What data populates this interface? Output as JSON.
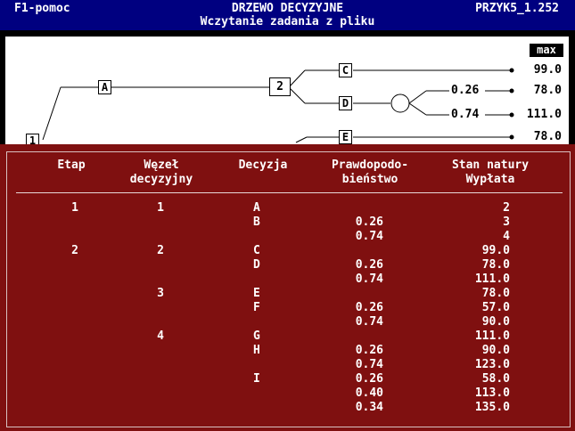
{
  "titlebar": {
    "help": "F1-pomoc",
    "title": "DRZEWO DECYZYJNE",
    "filename": "PRZYK5_1.252",
    "subtitle": "Wczytanie zadania z pliku"
  },
  "tree": {
    "max_label": "max",
    "node_1": "1",
    "node_A": "A",
    "node_2": "2",
    "node_C": "C",
    "node_D": "D",
    "node_E": "E",
    "prob_026": "0.26",
    "prob_074": "0.74",
    "payoff_C": "99.0",
    "payoff_D1": "78.0",
    "payoff_D2": "111.0",
    "payoff_E": "78.0"
  },
  "table": {
    "headers": {
      "stage": "Etap",
      "node": "Węzeł\ndecyzyjny",
      "decision": "Decyzja",
      "probability": "Prawdopodo-\nbieństwo",
      "payoff": "Stan natury\nWypłata"
    },
    "rows": [
      {
        "stage": "1",
        "node": "1",
        "decision": "A",
        "prob": "",
        "payoff": "2"
      },
      {
        "stage": "",
        "node": "",
        "decision": "B",
        "prob": "0.26",
        "payoff": "3"
      },
      {
        "stage": "",
        "node": "",
        "decision": "",
        "prob": "0.74",
        "payoff": "4"
      },
      {
        "stage": "2",
        "node": "2",
        "decision": "C",
        "prob": "",
        "payoff": "99.0"
      },
      {
        "stage": "",
        "node": "",
        "decision": "D",
        "prob": "0.26",
        "payoff": "78.0"
      },
      {
        "stage": "",
        "node": "",
        "decision": "",
        "prob": "0.74",
        "payoff": "111.0"
      },
      {
        "stage": "",
        "node": "3",
        "decision": "E",
        "prob": "",
        "payoff": "78.0"
      },
      {
        "stage": "",
        "node": "",
        "decision": "F",
        "prob": "0.26",
        "payoff": "57.0"
      },
      {
        "stage": "",
        "node": "",
        "decision": "",
        "prob": "0.74",
        "payoff": "90.0"
      },
      {
        "stage": "",
        "node": "4",
        "decision": "G",
        "prob": "",
        "payoff": "111.0"
      },
      {
        "stage": "",
        "node": "",
        "decision": "H",
        "prob": "0.26",
        "payoff": "90.0"
      },
      {
        "stage": "",
        "node": "",
        "decision": "",
        "prob": "0.74",
        "payoff": "123.0"
      },
      {
        "stage": "",
        "node": "",
        "decision": "I",
        "prob": "0.26",
        "payoff": "58.0"
      },
      {
        "stage": "",
        "node": "",
        "decision": "",
        "prob": "0.40",
        "payoff": "113.0"
      },
      {
        "stage": "",
        "node": "",
        "decision": "",
        "prob": "0.34",
        "payoff": "135.0"
      }
    ]
  },
  "colors": {
    "titlebar_bg": "#000080",
    "panel_bg": "#7f1010",
    "canvas_bg": "#ffffff"
  }
}
